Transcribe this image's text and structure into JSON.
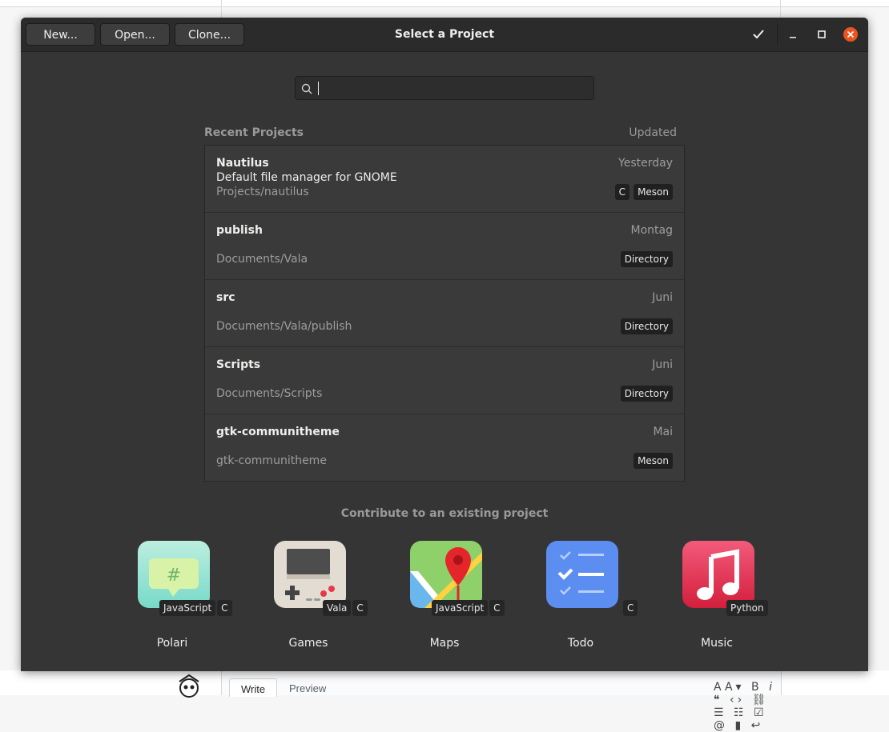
{
  "window": {
    "title": "Select a Project",
    "buttons": {
      "new": "New...",
      "open": "Open...",
      "clone": "Clone..."
    }
  },
  "search": {
    "value": "",
    "placeholder": ""
  },
  "recent": {
    "heading": "Recent Projects",
    "updated_label": "Updated",
    "projects": [
      {
        "name": "Nautilus",
        "description": "Default file manager for GNOME",
        "path": "Projects/nautilus",
        "updated": "Yesterday",
        "tags": [
          "C",
          "Meson"
        ]
      },
      {
        "name": "publish",
        "description": "",
        "path": "Documents/Vala",
        "updated": "Montag",
        "tags": [
          "Directory"
        ]
      },
      {
        "name": "src",
        "description": "",
        "path": "Documents/Vala/publish",
        "updated": "Juni",
        "tags": [
          "Directory"
        ]
      },
      {
        "name": "Scripts",
        "description": "",
        "path": "Documents/Scripts",
        "updated": "Juni",
        "tags": [
          "Directory"
        ]
      },
      {
        "name": "gtk-communitheme",
        "description": "",
        "path": "gtk-communitheme",
        "updated": "Mai",
        "tags": [
          "Meson"
        ]
      }
    ]
  },
  "contribute": {
    "heading": "Contribute to an existing project",
    "apps": [
      {
        "name": "Polari",
        "icon": "polari-chat-icon",
        "tags": [
          "JavaScript",
          "C"
        ]
      },
      {
        "name": "Games",
        "icon": "games-gameboy-icon",
        "tags": [
          "Vala",
          "C"
        ]
      },
      {
        "name": "Maps",
        "icon": "maps-pin-icon",
        "tags": [
          "JavaScript",
          "C"
        ]
      },
      {
        "name": "Todo",
        "icon": "todo-checklist-icon",
        "tags": [
          "C"
        ]
      },
      {
        "name": "Music",
        "icon": "music-note-icon",
        "tags": [
          "Python"
        ]
      }
    ]
  },
  "background": {
    "tabs": {
      "write": "Write",
      "preview": "Preview"
    }
  },
  "colors": {
    "close": "#e95420",
    "window_bg": "#353535",
    "header_bg": "#2b2b2b"
  }
}
